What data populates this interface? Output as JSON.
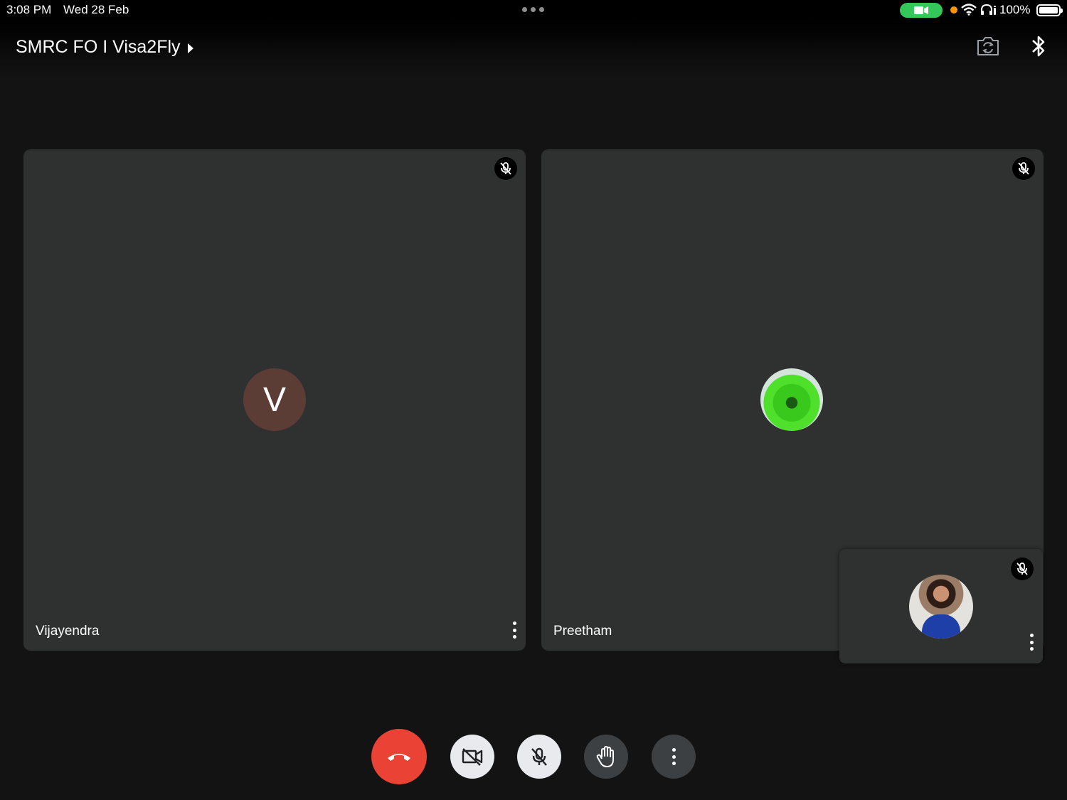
{
  "status_bar": {
    "time": "3:08 PM",
    "date": "Wed 28 Feb",
    "battery_percent": "100%",
    "battery_level": 1.0,
    "icons": [
      "camera-in-use-icon",
      "privacy-indicator-icon",
      "wifi-icon",
      "headphones-icon",
      "battery-icon"
    ],
    "camera_pill_color": "#34c759",
    "privacy_dot_color": "#ff9500"
  },
  "header": {
    "meeting_title": "SMRC FO I Visa2Fly",
    "icons": [
      "switch-camera-icon",
      "bluetooth-icon"
    ]
  },
  "participants": [
    {
      "name": "Vijayendra",
      "avatar_initial": "V",
      "avatar_color": "#5c3d35",
      "muted": true
    },
    {
      "name": "Preetham",
      "avatar": "photo",
      "muted": true
    }
  ],
  "self_view": {
    "avatar": "photo",
    "muted": true
  },
  "controls": [
    {
      "name": "end-call",
      "icon": "phone-hangup-icon",
      "color": "#ea4335"
    },
    {
      "name": "camera-off",
      "icon": "video-off-icon",
      "color": "#e8eaed"
    },
    {
      "name": "mic-off",
      "icon": "mic-off-icon",
      "color": "#e8eaed"
    },
    {
      "name": "raise-hand",
      "icon": "hand-icon",
      "color": "#3c4043"
    },
    {
      "name": "more-options",
      "icon": "more-vert-icon",
      "color": "#3c4043"
    }
  ]
}
